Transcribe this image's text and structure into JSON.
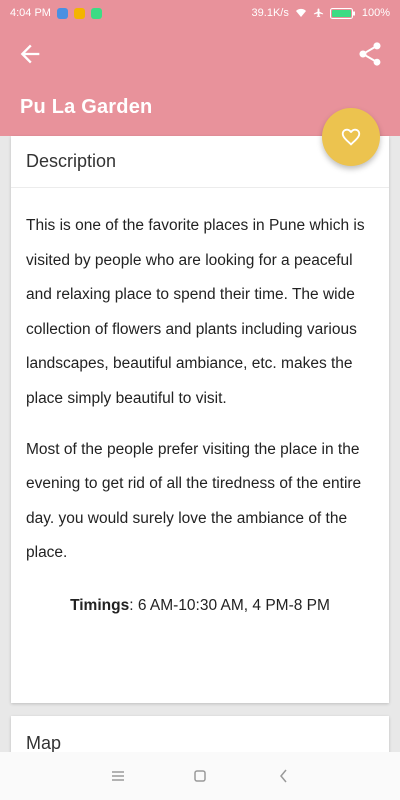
{
  "status_bar": {
    "time": "4:04 PM",
    "network_speed": "39.1K/s",
    "battery": "100%"
  },
  "app_bar": {
    "title": "Pu La Garden",
    "back_icon": "arrow-back-icon",
    "share_icon": "share-icon"
  },
  "fab": {
    "icon": "heart-outline-icon"
  },
  "description": {
    "header": "Description",
    "paragraphs": [
      "This is one of the favorite places in Pune which is visited by people who are looking for a peaceful and relaxing place to spend their time. The wide collection of flowers and plants including various landscapes, beautiful ambiance, etc. makes the place simply beautiful to visit.",
      "Most of the people prefer visiting the place in the evening to get rid of all the tiredness of the entire day. you would surely love the ambiance of the place."
    ],
    "timings_label": "Timings",
    "timings_value": ": 6 AM-10:30 AM, 4 PM-8 PM"
  },
  "map": {
    "header": "Map"
  },
  "nav_bar": {
    "menu_icon": "menu-icon",
    "home_icon": "home-square-icon",
    "back_icon": "back-chevron-icon"
  },
  "colors": {
    "primary": "#e8929b",
    "accent": "#ecc34f",
    "background": "#e8e8e8"
  }
}
